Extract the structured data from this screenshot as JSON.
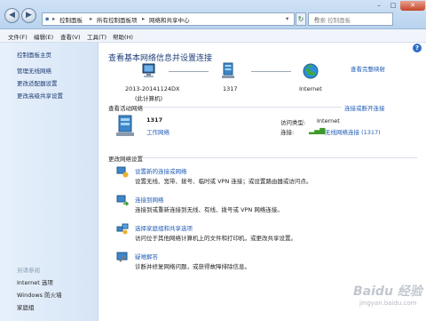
{
  "window": {
    "breadcrumb": [
      "控制面板",
      "所有控制面板项",
      "网络和共享中心"
    ],
    "search_placeholder": "搜索 控制面板"
  },
  "menu": [
    "文件(F)",
    "编辑(E)",
    "查看(V)",
    "工具(T)",
    "帮助(H)"
  ],
  "sidebar": {
    "links": [
      "控制面板主页",
      "管理无线网络",
      "更改适配器设置",
      "更改高级共享设置"
    ],
    "see_also_heading": "另请参阅",
    "see_also": [
      "Internet 选项",
      "Windows 防火墙",
      "家庭组"
    ]
  },
  "main": {
    "title": "查看基本网络信息并设置连接",
    "full_map_link": "查看完整映射",
    "map": {
      "computer_name": "2013-20141124DX",
      "computer_sub": "(此计算机)",
      "network": "1317",
      "internet": "Internet"
    },
    "active_networks": {
      "heading": "查看活动网络",
      "connect_link": "连接或断开连接",
      "name": "1317",
      "type_link": "工作网络",
      "access_label": "访问类型:",
      "access_value": "Internet",
      "connection_label": "连接:",
      "connection_value": "无线网络连接 (1317)"
    },
    "change_settings": {
      "heading": "更改网络设置",
      "items": [
        {
          "title": "设置新的连接或网络",
          "desc": "设置无线、宽带、拨号、临时或 VPN 连接；或设置路由器或访问点。"
        },
        {
          "title": "连接到网络",
          "desc": "连接到或重新连接到无线、有线、拨号或 VPN 网络连接。"
        },
        {
          "title": "选择家庭组和共享选项",
          "desc": "访问位于其他网络计算机上的文件和打印机，或更改共享设置。"
        },
        {
          "title": "疑难解答",
          "desc": "诊断并修复网络问题，或获得故障排除信息。"
        }
      ]
    }
  },
  "watermark": {
    "logo": "Baidu 经验",
    "sub": "jingyan.baidu.com"
  },
  "colors": {
    "link": "#1f5bb5",
    "title": "#1e3f7a",
    "signal": "#3c9a2a"
  }
}
